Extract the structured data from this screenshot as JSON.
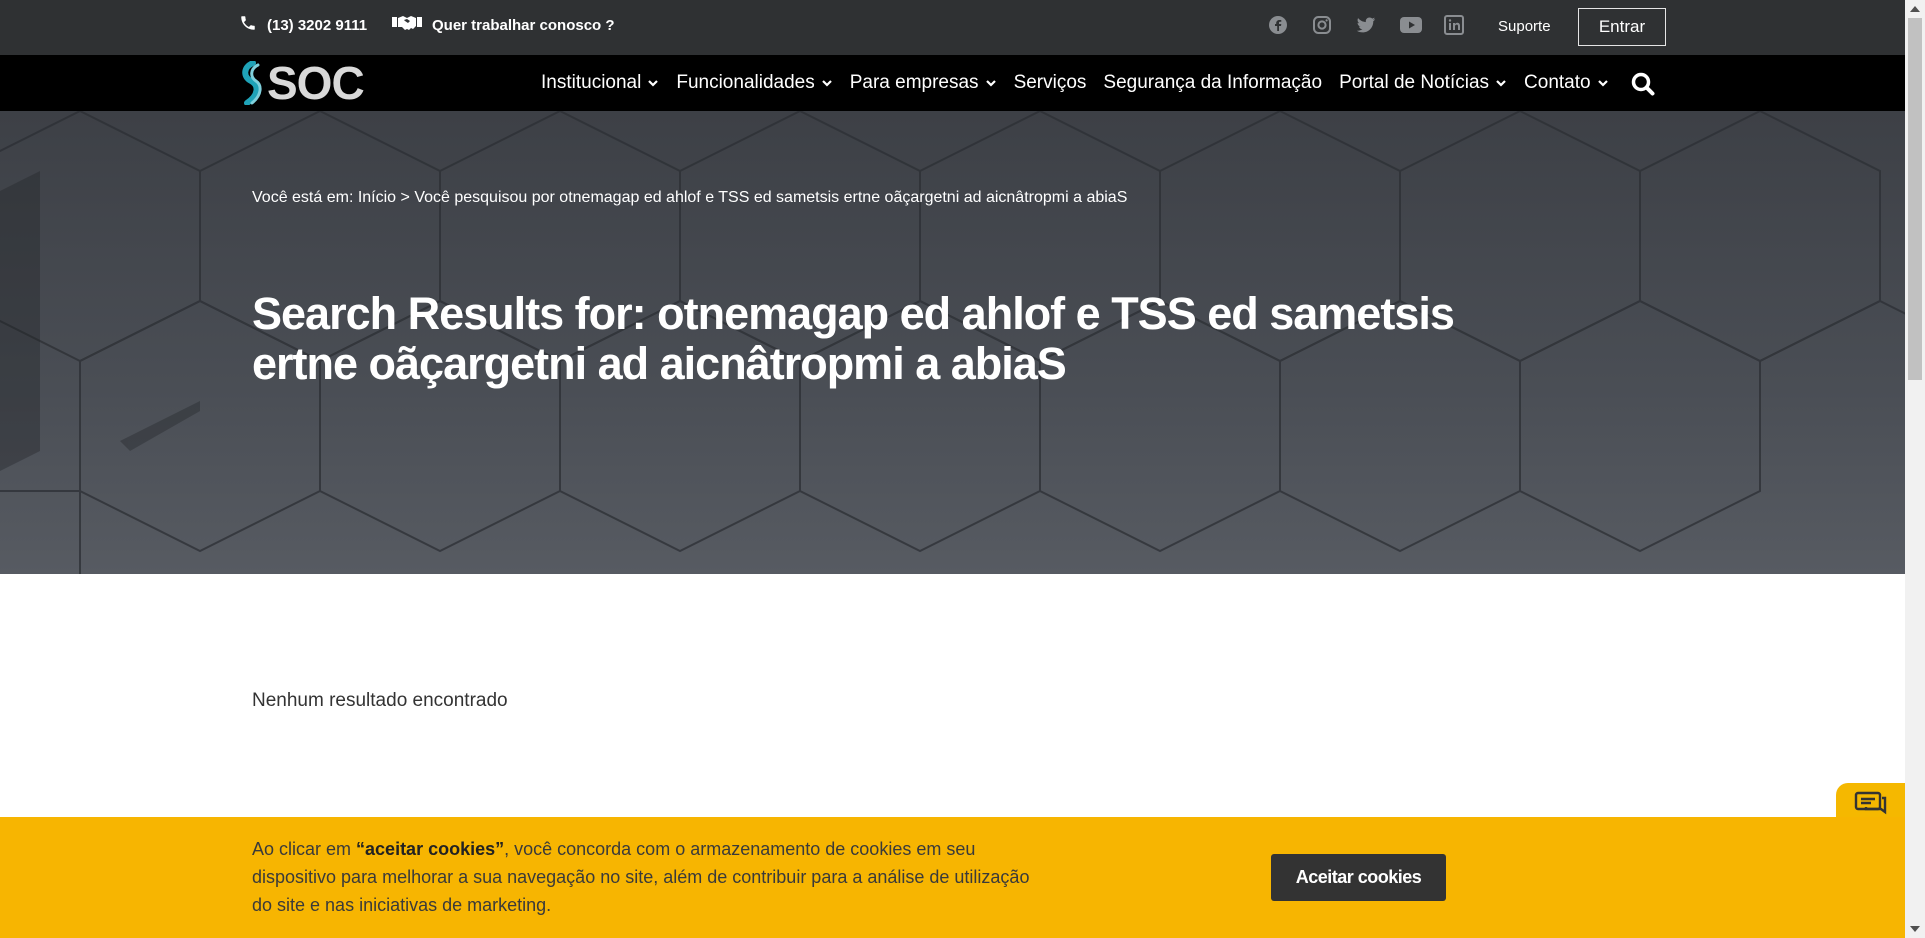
{
  "topbar": {
    "phone": "(13) 3202 9111",
    "work_link": "Quer trabalhar conosco ?",
    "socials": [
      "facebook-icon",
      "instagram-icon",
      "twitter-icon",
      "youtube-icon",
      "linkedin-icon"
    ],
    "support": "Suporte",
    "login": "Entrar"
  },
  "nav": {
    "logo": "SOC",
    "items": [
      {
        "label": "Institucional",
        "dropdown": true
      },
      {
        "label": "Funcionalidades",
        "dropdown": true
      },
      {
        "label": "Para empresas",
        "dropdown": true
      },
      {
        "label": "Serviços",
        "dropdown": false
      },
      {
        "label": "Segurança da Informação",
        "dropdown": false
      },
      {
        "label": "Portal de Notícias",
        "dropdown": true
      },
      {
        "label": "Contato",
        "dropdown": true
      }
    ]
  },
  "hero": {
    "breadcrumb": "Você está em: Início > Você pesquisou por otnemagap ed ahlof e TSS ed sametsis ertne oãçargetni ad aicnâtropmi a abiaS",
    "title": "Search Results for: otnemagap ed ahlof e TSS ed sametsis ertne oãçargetni ad aicnâtropmi a abiaS"
  },
  "content": {
    "no_results": "Nenhum resultado encontrado"
  },
  "cookie": {
    "text_before": "Ao clicar em ",
    "text_bold": "“aceitar cookies”",
    "text_after": ", você concorda com o armazenamento de cookies em seu dispositivo para melhorar a sua navegação no site, além de contribuir para a análise de utilização do site e nas iniciativas de marketing.",
    "accept": "Aceitar cookies"
  },
  "colors": {
    "topbar": "#2f3133",
    "navbar": "#000000",
    "accent": "#f7b501",
    "button_dark": "#333333"
  }
}
